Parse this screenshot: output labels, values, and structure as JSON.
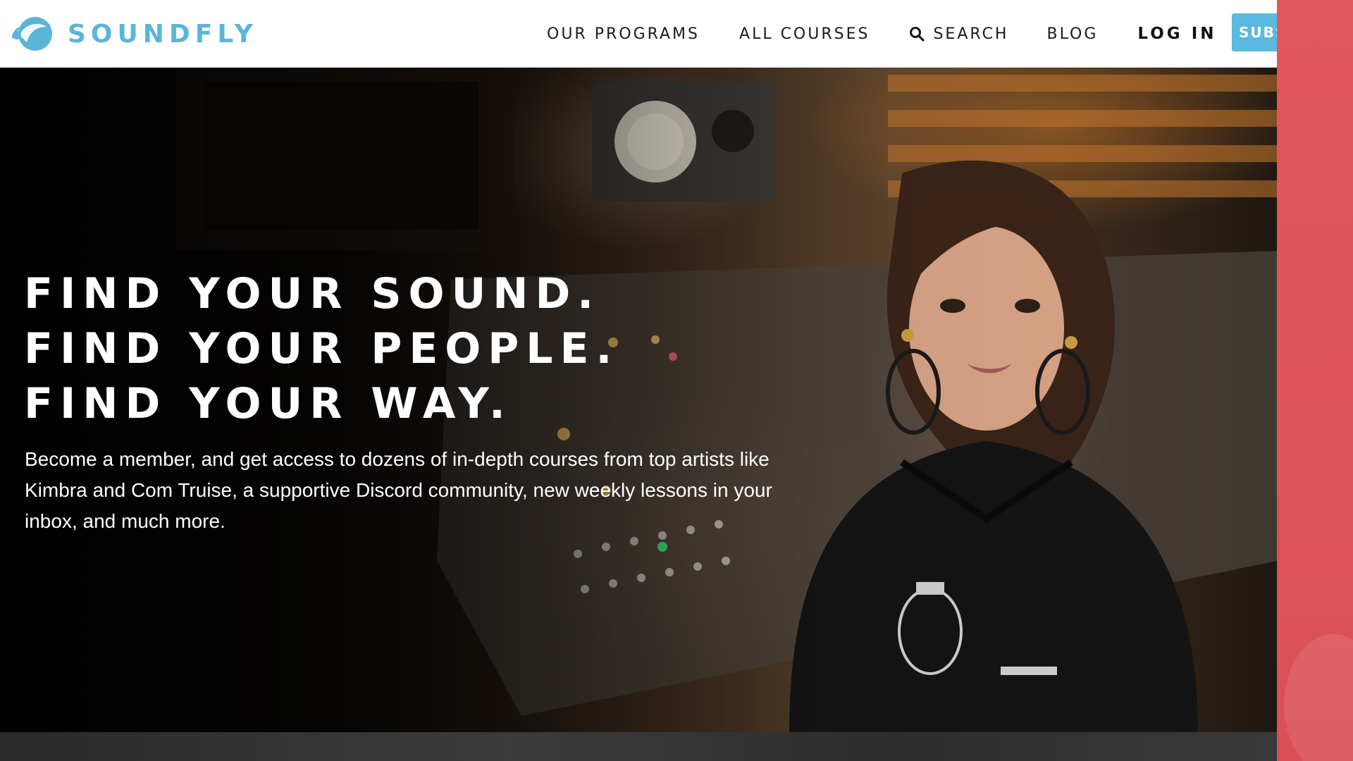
{
  "brand": {
    "name": "SOUNDFLY",
    "color": "#5bb6d6"
  },
  "nav": {
    "items": [
      {
        "label": "OUR PROGRAMS"
      },
      {
        "label": "ALL COURSES"
      },
      {
        "label": "SEARCH",
        "icon": "search-icon"
      },
      {
        "label": "BLOG"
      },
      {
        "label": "LOG IN"
      }
    ],
    "subscribe_label": "SUBSCRIBE",
    "subscribe_color": "#59b9de"
  },
  "hero": {
    "headline_lines": [
      "FIND YOUR SOUND.",
      "FIND YOUR PEOPLE.",
      "FIND YOUR WAY."
    ],
    "copy": "Become a member, and get access to dozens of in-depth courses from top artists like Kimbra and Com Truise, a supportive Discord community, new weekly lessons in your inbox, and much more."
  },
  "overlay": {
    "color": "#e0575c"
  }
}
